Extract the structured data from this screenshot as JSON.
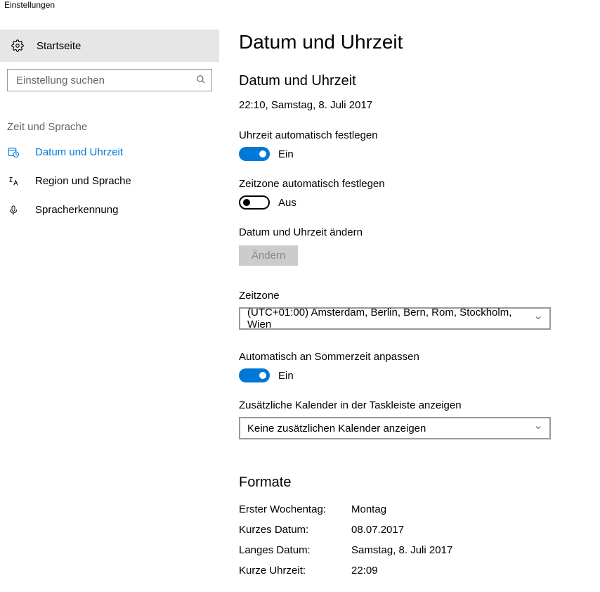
{
  "window_title": "Einstellungen",
  "sidebar": {
    "home_label": "Startseite",
    "search_placeholder": "Einstellung suchen",
    "section_label": "Zeit und Sprache",
    "items": [
      {
        "label": "Datum und Uhrzeit"
      },
      {
        "label": "Region und Sprache"
      },
      {
        "label": "Spracherkennung"
      }
    ]
  },
  "main": {
    "page_title": "Datum und Uhrzeit",
    "subheading": "Datum und Uhrzeit",
    "current_datetime": "22:10, Samstag, 8. Juli 2017",
    "auto_time_label": "Uhrzeit automatisch festlegen",
    "auto_time_state": "Ein",
    "auto_tz_label": "Zeitzone automatisch festlegen",
    "auto_tz_state": "Aus",
    "change_label": "Datum und Uhrzeit ändern",
    "change_button": "Ändern",
    "timezone_label": "Zeitzone",
    "timezone_value": "(UTC+01:00) Amsterdam, Berlin, Bern, Rom, Stockholm, Wien",
    "dst_label": "Automatisch an Sommerzeit anpassen",
    "dst_state": "Ein",
    "extra_cal_label": "Zusätzliche Kalender in der Taskleiste anzeigen",
    "extra_cal_value": "Keine zusätzlichen Kalender anzeigen",
    "formats_heading": "Formate",
    "formats": {
      "first_day_label": "Erster Wochentag:",
      "first_day_value": "Montag",
      "short_date_label": "Kurzes Datum:",
      "short_date_value": "08.07.2017",
      "long_date_label": "Langes Datum:",
      "long_date_value": "Samstag, 8. Juli 2017",
      "short_time_label": "Kurze Uhrzeit:",
      "short_time_value": "22:09"
    }
  }
}
